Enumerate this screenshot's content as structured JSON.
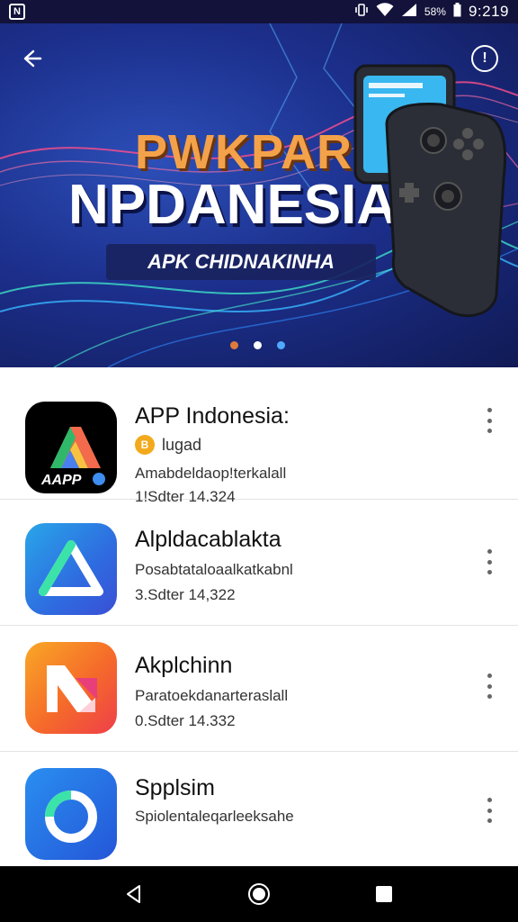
{
  "status_bar": {
    "battery": "58%",
    "time": "9:219"
  },
  "hero": {
    "title_top": "PWKPAR",
    "title_main": "NPDANESIA",
    "subtitle": "APK CHIDNAKINHA",
    "carousel": {
      "count": 3,
      "active_index": 1
    }
  },
  "apps": [
    {
      "name": "APP Indonesia:",
      "tag": "lugad",
      "line1": "Amabdeldaop!terkalall",
      "line2": "1!Sdter 14.324",
      "icon_text": "AAPP"
    },
    {
      "name": "Alpldacablakta",
      "line1": "Posabtataloaalkatkabnl",
      "line2": "3.Sdter 14,322"
    },
    {
      "name": "Akplchinn",
      "line1": "Paratoekdanarteraslall",
      "line2": "0.Sdter 14.332"
    },
    {
      "name": "Spplsim",
      "line1": "Spiolentaleqarleeksahe"
    }
  ],
  "colors": {
    "hero_bg": "#1c2f8c",
    "accent_orange": "#f3a24a",
    "dot_orange": "#e07a3a",
    "dot_white": "#ffffff",
    "dot_blue": "#4fa9ff"
  }
}
